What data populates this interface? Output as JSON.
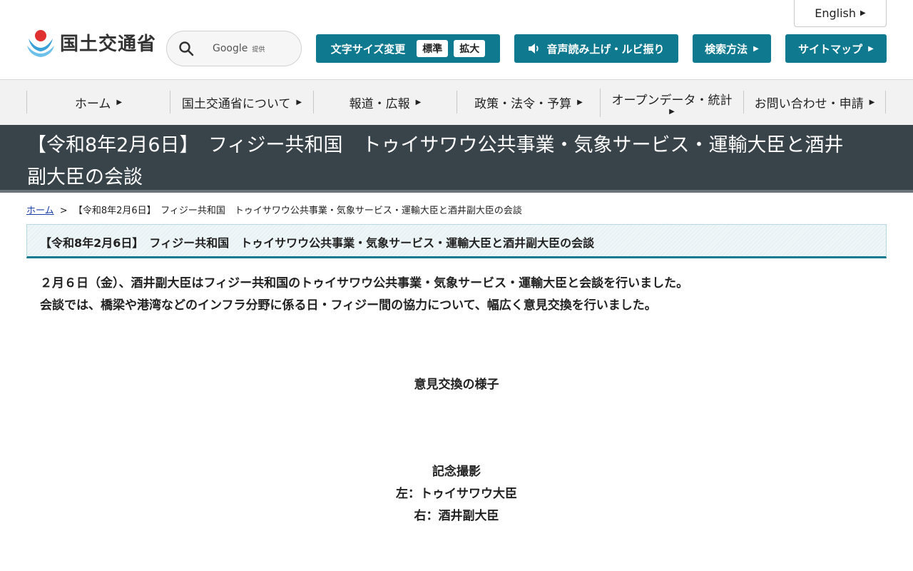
{
  "header": {
    "english_label": "English",
    "logo_text": "国土交通省",
    "search": {
      "provider": "Google",
      "provider_sub": "提供"
    },
    "text_size": {
      "label": "文字サイズ変更",
      "normal": "標準",
      "large": "拡大"
    },
    "read_aloud_label": "音声読み上げ・ルビ振り",
    "search_method_label": "検索方法",
    "sitemap_label": "サイトマップ",
    "accent_color": "#0f7a8f"
  },
  "nav": {
    "items": [
      {
        "label": "ホーム"
      },
      {
        "label": "国土交通省について"
      },
      {
        "label": "報道・広報"
      },
      {
        "label": "政策・法令・予算"
      },
      {
        "label": "オープンデータ・統計"
      },
      {
        "label": "お問い合わせ・申請"
      }
    ]
  },
  "page": {
    "title_line1": "【令和8年2月6日】　フィジー共和国　トゥイサワウ公共事業・気象サービス・運輸大臣と酒井",
    "title_line2": "副大臣の会談",
    "breadcrumb": {
      "home": "ホーム",
      "separator": ">",
      "current": "【令和8年2月6日】　フィジー共和国　トゥイサワウ公共事業・気象サービス・運輸大臣と酒井副大臣の会談"
    },
    "section_heading": "【令和8年2月6日】　フィジー共和国　トゥイサワウ公共事業・気象サービス・運輸大臣と酒井副大臣の会談",
    "body_lines": [
      "２月６日（金）、酒井副大臣はフィジー共和国のトゥイサワウ公共事業・気象サービス・運輸大臣と会談を行いました。",
      "会談では、橋梁や港湾などのインフラ分野に係る日・フィジー間の協力について、幅広く意見交換を行いました。"
    ],
    "caption1": "意見交換の様子",
    "caption2_lines": [
      "記念撮影",
      "左：トゥイサワウ大臣",
      "右：酒井副大臣"
    ]
  }
}
